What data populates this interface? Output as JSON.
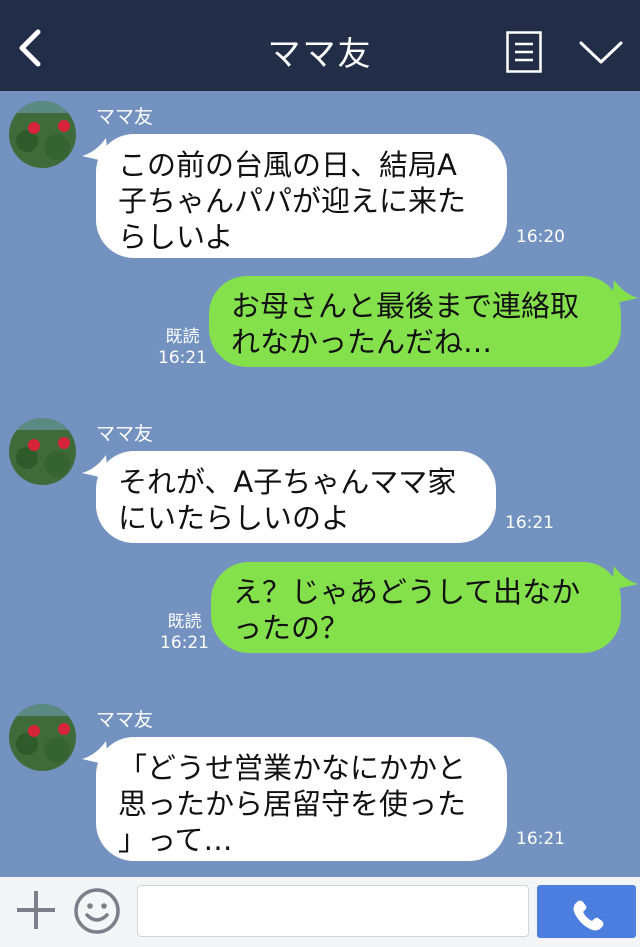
{
  "header": {
    "title": "ママ友",
    "back_icon": "chevron-left-icon",
    "menu_icon": "menu-icon",
    "expand_icon": "chevron-down-icon"
  },
  "messages": [
    {
      "sender": "ママ友",
      "text": "この前の台風の日、結局A\n子ちゃんパパが迎えに来た\nらしいよ",
      "time": "16:20"
    },
    {
      "text": "お母さんと最後まで連絡取\nれなかったんだね…",
      "read": "既読",
      "time": "16:21"
    },
    {
      "sender": "ママ友",
      "text": "それが、A子ちゃんママ家\nにいたらしいのよ",
      "time": "16:21"
    },
    {
      "text": "え？じゃあどうして出なか\nったの？",
      "read": "既読",
      "time": "16:21"
    },
    {
      "sender": "ママ友",
      "text": "「どうせ営業かなにかかと\n思ったから居留守を使った\n」って…",
      "time": "16:21"
    }
  ],
  "footer": {
    "input_value": "",
    "add_icon": "plus-icon",
    "emoji_icon": "smiley-icon",
    "call_icon": "phone-icon"
  },
  "colors": {
    "header_bg": "#222e47",
    "chat_bg": "#7392c0",
    "incoming_bubble": "#ffffff",
    "outgoing_bubble": "#84e14b",
    "call_button": "#4c7ee0"
  }
}
